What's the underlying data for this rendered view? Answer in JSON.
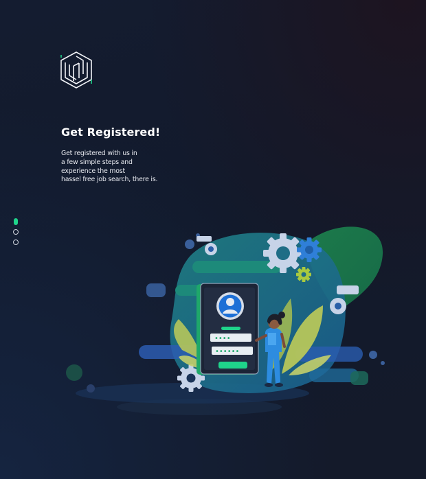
{
  "brand": {
    "logo_icon": "cube-logo-icon",
    "accent": "#1fd48b"
  },
  "content": {
    "title": "Get Registered!",
    "description_lines": [
      "Get registered with us in",
      "a few simple steps and",
      "experience the most",
      "hassel free job search, there is."
    ]
  },
  "carousel": {
    "slide_count": 3,
    "active_index": 0,
    "active_color": "#1fd48b",
    "inactive_color": "#cfd3dc"
  },
  "illustration": {
    "icon": "registration-phone-illustration",
    "password_mask_1": "••••",
    "password_mask_2": "••••••",
    "colors": {
      "teal": "#1e7a7a",
      "green": "#1a7a55",
      "blue": "#2a5fa8",
      "gear": "#c7d3e8",
      "leaf": "#b6c65a"
    }
  }
}
